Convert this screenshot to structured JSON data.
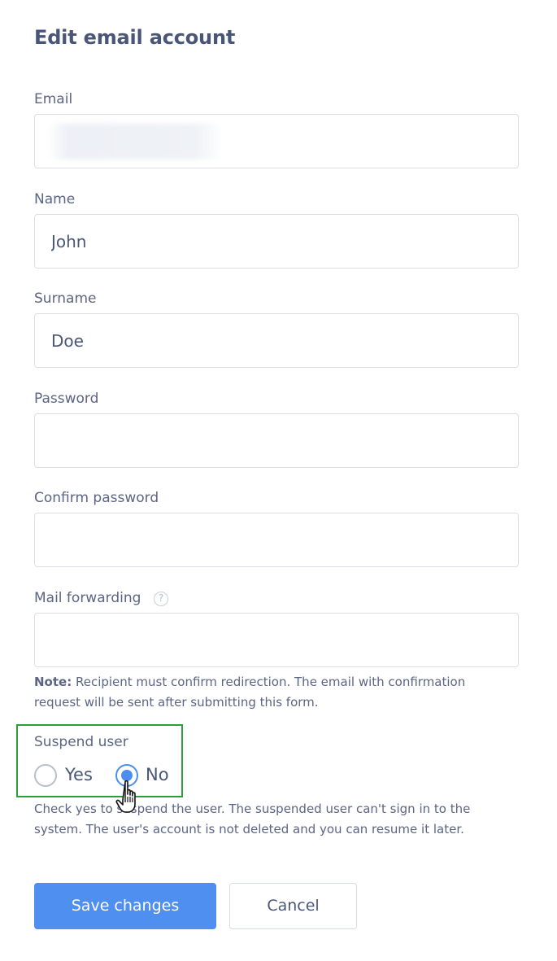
{
  "page": {
    "title": "Edit email account"
  },
  "form": {
    "email": {
      "label": "Email",
      "value": ""
    },
    "name": {
      "label": "Name",
      "value": "John"
    },
    "surname": {
      "label": "Surname",
      "value": "Doe"
    },
    "password": {
      "label": "Password",
      "value": ""
    },
    "confirm_password": {
      "label": "Confirm password",
      "value": ""
    },
    "mail_forwarding": {
      "label": "Mail forwarding",
      "help_icon": "question-circle-icon",
      "help_glyph": "?",
      "value": ""
    },
    "note": {
      "prefix": "Note:",
      "text": " Recipient must confirm redirection. The email with confirmation request will be sent after submitting this form."
    },
    "suspend_user": {
      "label": "Suspend user",
      "options": [
        {
          "label": "Yes",
          "selected": false
        },
        {
          "label": "No",
          "selected": true
        }
      ],
      "hint": "Check yes to suspend the user. The suspended user can't sign in to the system. The user's account is not deleted and you can resume it later."
    }
  },
  "actions": {
    "save_label": "Save changes",
    "cancel_label": "Cancel"
  },
  "colors": {
    "primary": "#4f8ff0",
    "highlight_border": "#2e9e3a",
    "text": "#4a5678"
  }
}
